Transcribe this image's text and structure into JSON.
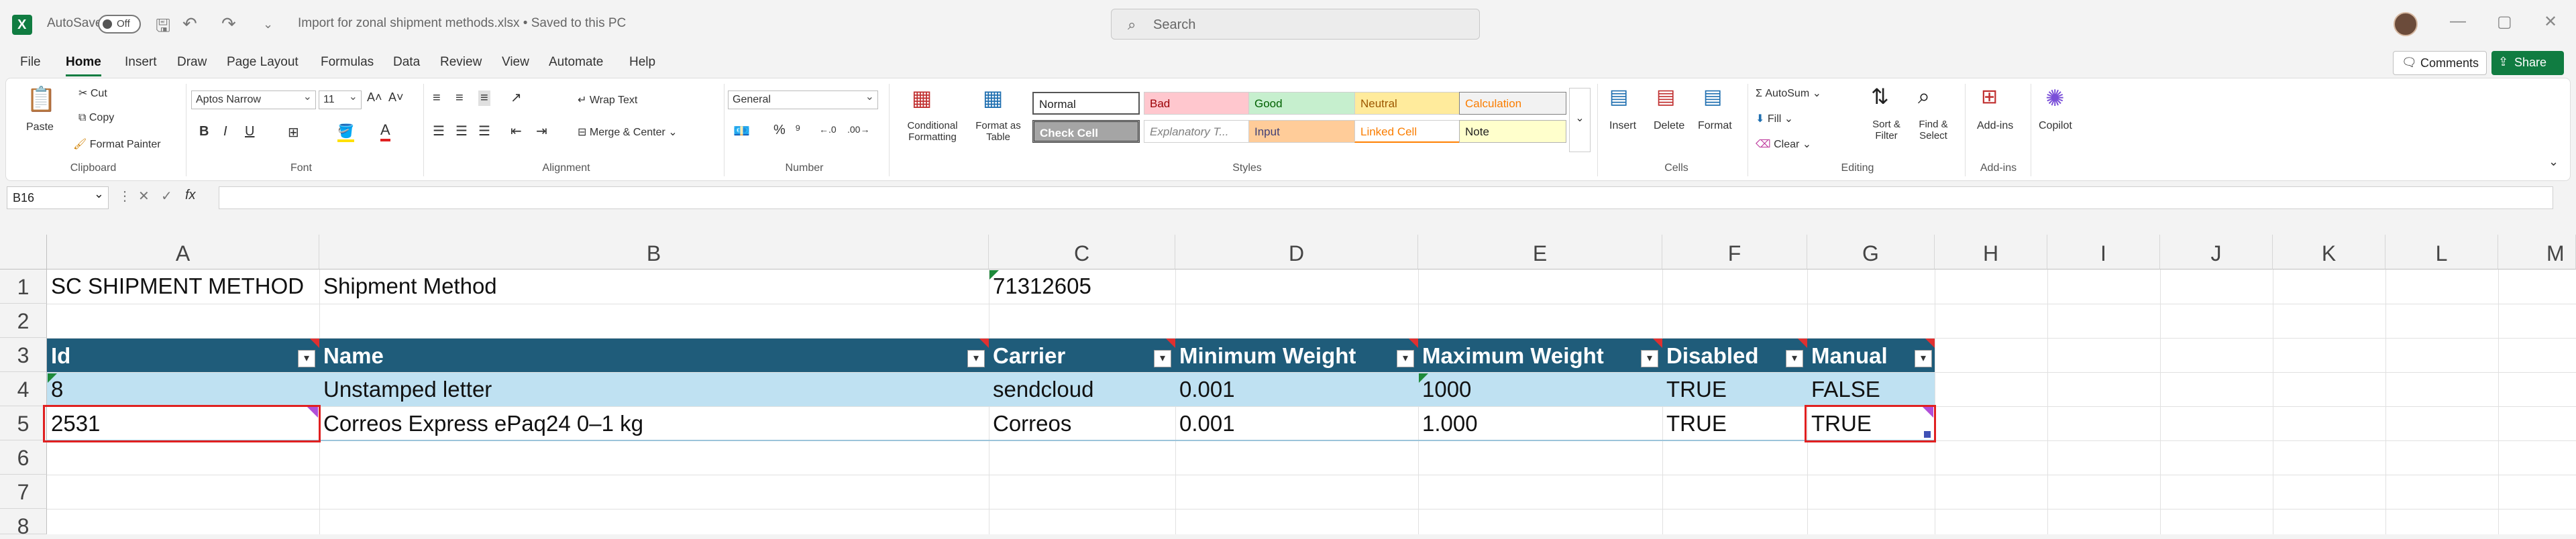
{
  "titlebar": {
    "autosave_label": "AutoSave",
    "autosave_state": "Off",
    "file_title": "Import for zonal shipment methods.xlsx • Saved to this PC",
    "search_placeholder": "Search"
  },
  "menu": {
    "items": [
      "File",
      "Home",
      "Insert",
      "Draw",
      "Page Layout",
      "Formulas",
      "Data",
      "Review",
      "View",
      "Automate",
      "Help"
    ],
    "active": "Home",
    "comments": "Comments",
    "share": "Share"
  },
  "ribbon": {
    "clipboard": {
      "paste": "Paste",
      "cut": "Cut",
      "copy": "Copy",
      "format_painter": "Format Painter",
      "label": "Clipboard"
    },
    "font": {
      "name": "Aptos Narrow",
      "size": "11",
      "label": "Font"
    },
    "alignment": {
      "wrap": "Wrap Text",
      "merge": "Merge & Center",
      "label": "Alignment"
    },
    "number": {
      "format": "General",
      "label": "Number"
    },
    "styles": {
      "conditional": "Conditional Formatting",
      "format_table": "Format as Table",
      "label": "Styles",
      "cells": [
        "Normal",
        "Bad",
        "Good",
        "Neutral",
        "Calculation",
        "Check Cell",
        "Explanatory T...",
        "Input",
        "Linked Cell",
        "Note"
      ],
      "colors": {
        "Normal": "#ffffff",
        "Bad": "#ffc7ce",
        "Good": "#c6efce",
        "Neutral": "#ffeb9c",
        "Calculation": "#f2f2f2",
        "Check Cell": "#a5a5a5",
        "Explanatory T...": "#ffffff",
        "Input": "#ffcc99",
        "Linked Cell": "#ffffff",
        "Note": "#ffffcc"
      }
    },
    "cells": {
      "insert": "Insert",
      "delete": "Delete",
      "format": "Format",
      "label": "Cells"
    },
    "editing": {
      "autosum": "AutoSum",
      "fill": "Fill",
      "clear": "Clear",
      "sort": "Sort & Filter",
      "find": "Find & Select",
      "label": "Editing"
    },
    "addins": {
      "addins": "Add-ins",
      "label": "Add-ins"
    },
    "copilot": "Copilot"
  },
  "formula_bar": {
    "name_box": "B16",
    "fx": "fx",
    "value": ""
  },
  "sheet": {
    "columns": [
      "A",
      "B",
      "C",
      "D",
      "E",
      "F",
      "G",
      "H",
      "I",
      "J",
      "K",
      "L",
      "M"
    ],
    "rows": [
      "1",
      "2",
      "3",
      "4",
      "5",
      "6",
      "7",
      "8"
    ],
    "row1": {
      "A": "SC SHIPMENT METHOD",
      "B": "Shipment Method",
      "C": "71312605"
    },
    "headers": [
      "Id",
      "Name",
      "Carrier",
      "Minimum Weight",
      "Maximum Weight",
      "Disabled",
      "Manual"
    ],
    "data": [
      [
        "8",
        "Unstamped letter",
        "sendcloud",
        "0.001",
        "1000",
        "TRUE",
        "FALSE"
      ],
      [
        "2531",
        "Correos Express ePaq24 0–1 kg",
        "Correos",
        "0.001",
        "1.000",
        "TRUE",
        "TRUE"
      ]
    ],
    "colors": {
      "header_band": "#1f5c7a",
      "row_band": "#bfe1f2",
      "highlight": "#e02020"
    }
  }
}
